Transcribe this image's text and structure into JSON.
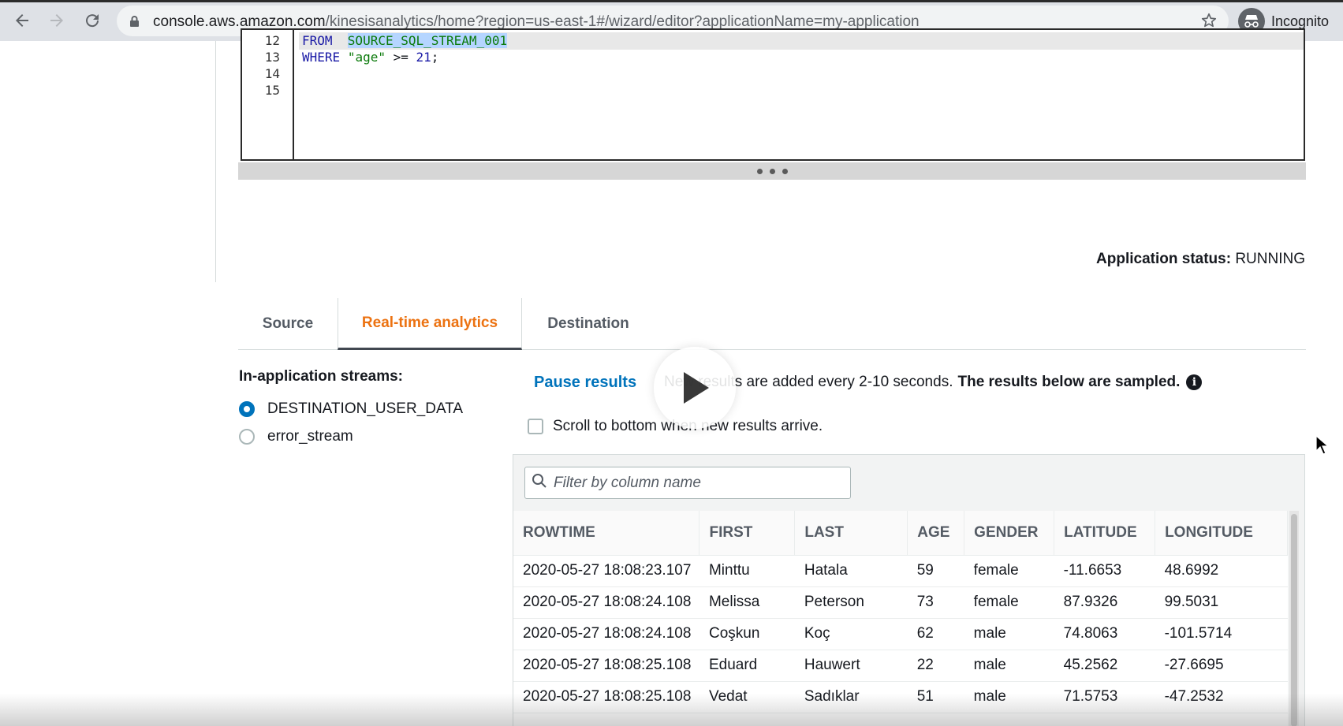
{
  "browser": {
    "url_host": "console.aws.amazon.com",
    "url_path": "/kinesisanalytics/home?region=us-east-1#/wizard/editor?applicationName=my-application",
    "profile_label": "Incognito",
    "icons": [
      "back-arrow-icon",
      "forward-arrow-icon",
      "reload-icon",
      "lock-icon",
      "star-icon",
      "incognito-icon"
    ]
  },
  "editor": {
    "lines": [
      {
        "number": "12",
        "text": "FROM  SOURCE_SQL_STREAM_001"
      },
      {
        "number": "13",
        "text": "WHERE \"age\" >= 21;"
      },
      {
        "number": "14",
        "text": ""
      },
      {
        "number": "15",
        "text": ""
      }
    ],
    "line12_keyword": "FROM",
    "line12_selection": "SOURCE_SQL_STREAM_001",
    "line13_keyword": "WHERE",
    "line13_string": "\"age\"",
    "line13_op": ">=",
    "line13_number": "21",
    "line13_end": ";"
  },
  "status": {
    "label": "Application status:",
    "value": "RUNNING"
  },
  "tabs": [
    {
      "label": "Source",
      "active": false
    },
    {
      "label": "Real-time analytics",
      "active": true
    },
    {
      "label": "Destination",
      "active": false
    }
  ],
  "streams": {
    "title": "In-application streams:",
    "options": [
      {
        "label": "DESTINATION_USER_DATA",
        "selected": true
      },
      {
        "label": "error_stream",
        "selected": false
      }
    ]
  },
  "results": {
    "pause_label": "Pause results",
    "info_text": "New results are added every 2-10 seconds.",
    "info_bold": "The results below are sampled.",
    "scroll_label": "Scroll to bottom when new results arrive.",
    "filter_placeholder": "Filter by column name",
    "columns": [
      "ROWTIME",
      "FIRST",
      "LAST",
      "AGE",
      "GENDER",
      "LATITUDE",
      "LONGITUDE"
    ],
    "rows": [
      [
        "2020-05-27 18:08:23.107",
        "Minttu",
        "Hatala",
        "59",
        "female",
        "-11.6653",
        "48.6992"
      ],
      [
        "2020-05-27 18:08:24.108",
        "Melissa",
        "Peterson",
        "73",
        "female",
        "87.9326",
        "99.5031"
      ],
      [
        "2020-05-27 18:08:24.108",
        "Coşkun",
        "Koç",
        "62",
        "male",
        "74.8063",
        "-101.5714"
      ],
      [
        "2020-05-27 18:08:25.108",
        "Eduard",
        "Hauwert",
        "22",
        "male",
        "45.2562",
        "-27.6695"
      ],
      [
        "2020-05-27 18:08:25.108",
        "Vedat",
        "Sadıklar",
        "51",
        "male",
        "71.5753",
        "-47.2532"
      ]
    ]
  },
  "colors": {
    "accent_orange": "#ec7211",
    "link_blue": "#0073bb",
    "chrome_gray": "#dee1e6"
  }
}
